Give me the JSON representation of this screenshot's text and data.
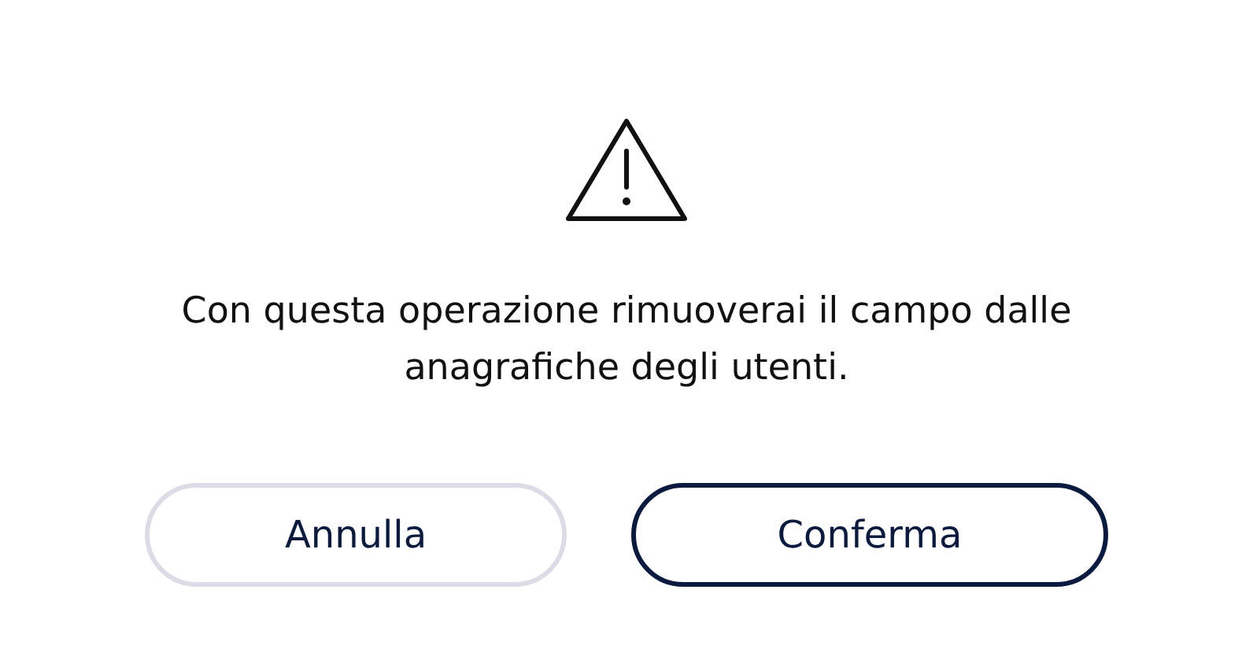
{
  "dialog": {
    "message": "Con questa operazione rimuoverai il campo dalle anagrafiche degli utenti.",
    "buttons": [
      {
        "label": "Annulla",
        "kind": "secondary"
      },
      {
        "label": "Conferma",
        "kind": "primary"
      }
    ]
  }
}
